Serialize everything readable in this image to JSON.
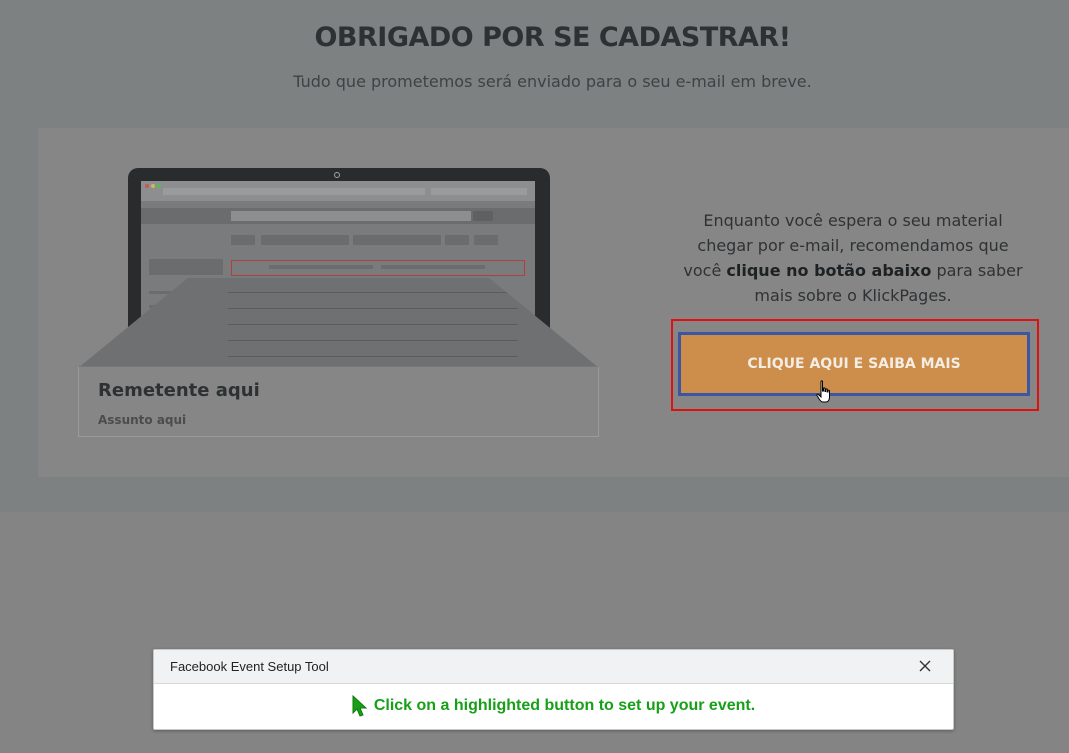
{
  "header": {
    "title": "OBRIGADO POR SE CADASTRAR!",
    "subtitle": "Tudo que prometemos será enviado para o seu e-mail em breve."
  },
  "email_preview": {
    "sender": "Remetente aqui",
    "subject": "Assunto aqui"
  },
  "description": {
    "part1": "Enquanto você espera o seu material chegar por e-mail, recomendamos que você ",
    "bold": "clique no botão abaixo",
    "part2": " para saber mais sobre o KlickPages."
  },
  "cta": {
    "label": "CLIQUE AQUI E SAIBA MAIS"
  },
  "popup": {
    "title": "Facebook Event Setup Tool",
    "message": "Click on a highlighted button to set up your event."
  },
  "colors": {
    "cta_bg": "#cd8d4b",
    "cta_highlight_inner": "#3d56a4",
    "cta_highlight_outer": "#e01010",
    "popup_message": "#17a017"
  }
}
